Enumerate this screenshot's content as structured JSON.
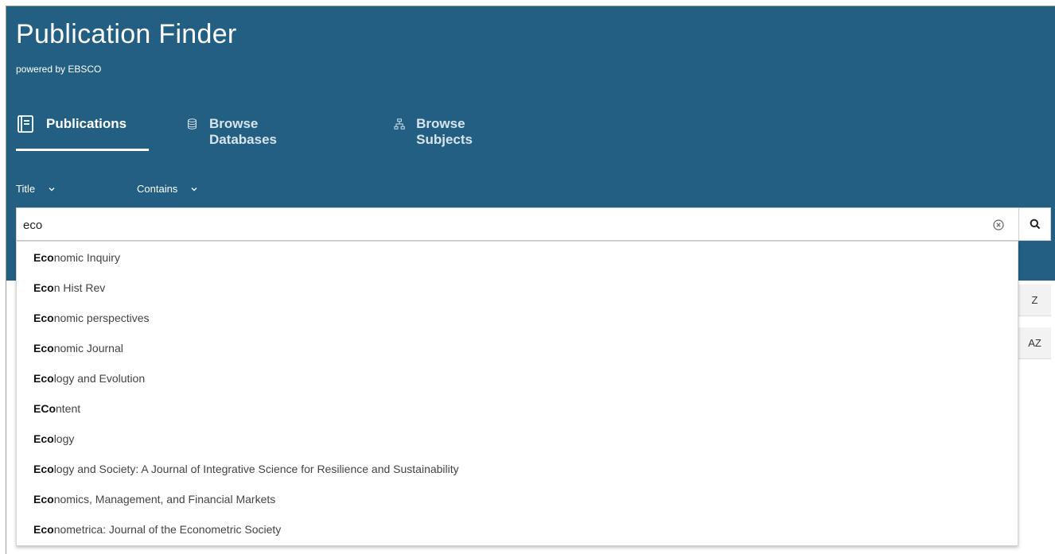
{
  "app": {
    "title": "Publication Finder",
    "subtitle": "powered by EBSCO"
  },
  "tabs": [
    {
      "label": "Publications",
      "icon": "publication-icon",
      "active": true
    },
    {
      "label": "Browse Databases",
      "icon": "database-icon",
      "active": false
    },
    {
      "label": "Browse Subjects",
      "icon": "sitemap-icon",
      "active": false
    }
  ],
  "filters": {
    "field": "Title",
    "match": "Contains"
  },
  "search": {
    "value": "eco"
  },
  "suggestions": [
    {
      "match": "Eco",
      "rest": "nomic Inquiry"
    },
    {
      "match": "Eco",
      "rest": "n Hist Rev"
    },
    {
      "match": "Eco",
      "rest": "nomic perspectives"
    },
    {
      "match": "Eco",
      "rest": "nomic Journal"
    },
    {
      "match": "Eco",
      "rest": "logy and Evolution"
    },
    {
      "match": "ECo",
      "rest": "ntent"
    },
    {
      "match": "Eco",
      "rest": "logy"
    },
    {
      "match": "Eco",
      "rest": "logy and Society: A Journal of Integrative Science for Resilience and Sustainability"
    },
    {
      "match": "Eco",
      "rest": "nomics, Management, and Financial Markets"
    },
    {
      "match": "Eco",
      "rest": "nometrica: Journal of the Econometric Society"
    }
  ],
  "side_buttons": {
    "z": "Z",
    "az": "AZ"
  },
  "colors": {
    "header_bg": "#225f83",
    "text_on_header": "#ffffff"
  }
}
